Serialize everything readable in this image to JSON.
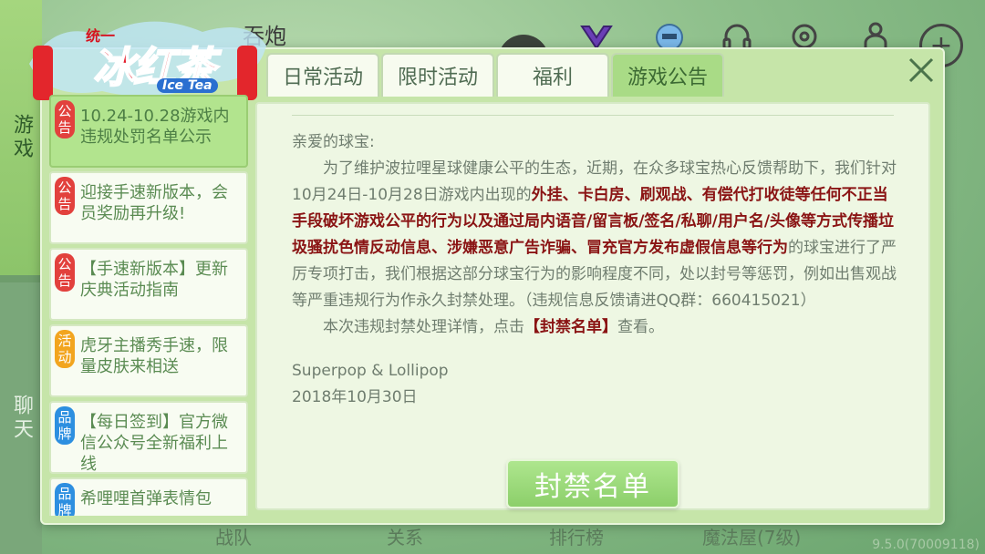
{
  "rail": {
    "game_tab": "游戏",
    "chat_tab": "聊天"
  },
  "header": {
    "name_fragment": "吞炮"
  },
  "logo": {
    "brand_small": "统一",
    "brand_main": "冰红茶",
    "brand_en": "Ice Tea"
  },
  "tabs": [
    {
      "label": "日常活动"
    },
    {
      "label": "限时活动"
    },
    {
      "label": "福利"
    },
    {
      "label": "游戏公告"
    }
  ],
  "announcements": [
    {
      "badge": "公告",
      "badge_color": "#e2413d",
      "text": "10.24-10.28游戏内违规处罚名单公示"
    },
    {
      "badge": "公告",
      "badge_color": "#e2413d",
      "text": "迎接手速新版本，会员奖励再升级!"
    },
    {
      "badge": "公告",
      "badge_color": "#e2413d",
      "text": "【手速新版本】更新庆典活动指南"
    },
    {
      "badge": "活动",
      "badge_color": "#f2a51f",
      "text": "虎牙主播秀手速，限量皮肤来相送"
    },
    {
      "badge": "品牌",
      "badge_color": "#2d8fe0",
      "text": "【每日签到】官方微信公众号全新福利上线"
    },
    {
      "badge": "品牌",
      "badge_color": "#2d8fe0",
      "text": "希哩哩首弹表情包"
    }
  ],
  "article": {
    "greeting": "亲爱的球宝:",
    "p1_a": "为了维护波拉哩星球健康公平的生态，近期，在众多球宝热心反馈帮助下，我们针对10月24日-10月28日游戏内出现的",
    "p1_highlight": "外挂、卡白房、刷观战、有偿代打收徒等任何不正当手段破坏游戏公平的行为以及通过局内语音/留言板/签名/私聊/用户名/头像等方式传播垃圾骚扰色情反动信息、涉嫌恶意广告诈骗、冒充官方发布虚假信息等行为",
    "p1_b": "的球宝进行了严厉专项打击，我们根据这部分球宝行为的影响程度不同，处以封号等惩罚，例如出售观战等严重违规行为作永久封禁处理。（违规信息反馈请进QQ群：660415021）",
    "p2_a": "本次违规封禁处理详情，点击",
    "p2_link": "【封禁名单】",
    "p2_b": "查看。",
    "signature": "Superpop & Lollipop",
    "date": "2018年10月30日"
  },
  "ban_button": "封禁名单",
  "bottom_nav": [
    "战队",
    "关系",
    "排行榜",
    "魔法屋(7级)"
  ],
  "version": "9.5.0(70009118)",
  "colors": {
    "accent_green": "#a9db86",
    "highlight_red": "#8a1414"
  }
}
